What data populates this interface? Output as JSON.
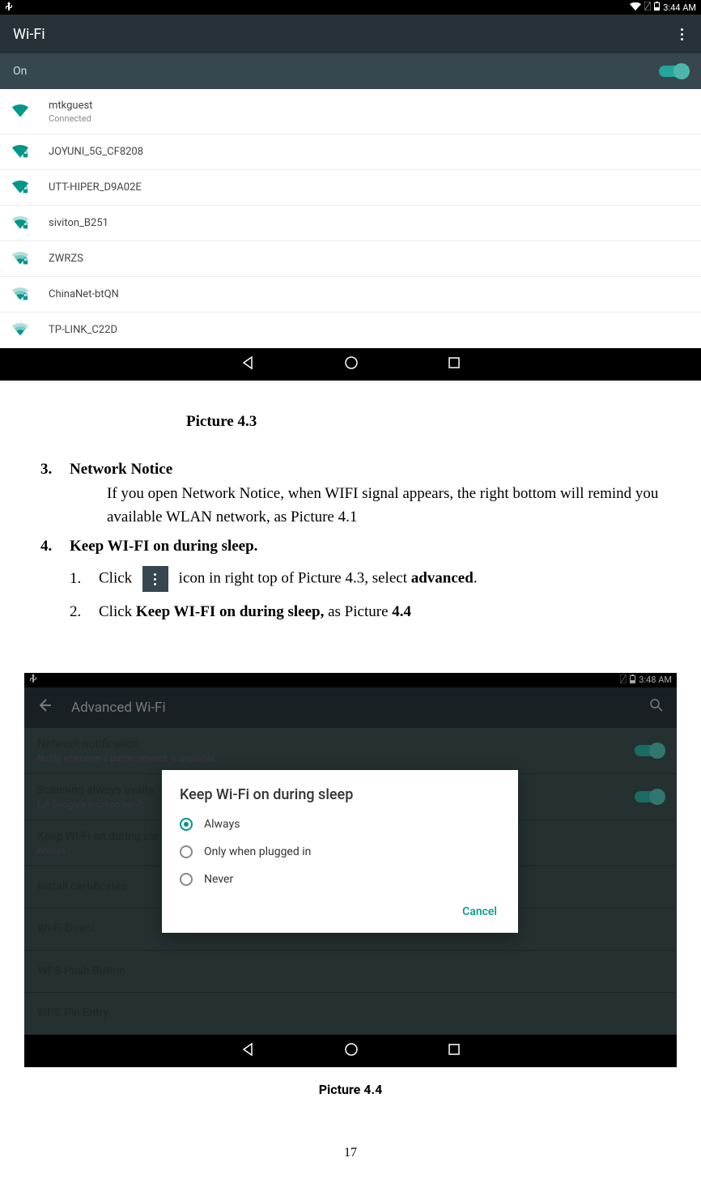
{
  "shot1": {
    "status_time": "3:44 AM",
    "title": "Wi-Fi",
    "on_label": "On",
    "networks": [
      {
        "name": "mtkguest",
        "status": "Connected",
        "strength": "full",
        "locked": false
      },
      {
        "name": "JOYUNI_5G_CF8208",
        "status": "",
        "strength": "full",
        "locked": true
      },
      {
        "name": "UTT-HIPER_D9A02E",
        "status": "",
        "strength": "full",
        "locked": true
      },
      {
        "name": "siviton_B251",
        "status": "",
        "strength": "high",
        "locked": true
      },
      {
        "name": "ZWRZS",
        "status": "",
        "strength": "med",
        "locked": true
      },
      {
        "name": "ChinaNet-btQN",
        "status": "",
        "strength": "med",
        "locked": true
      },
      {
        "name": "TP-LINK_C22D",
        "status": "",
        "strength": "med",
        "locked": false
      }
    ]
  },
  "caption1": "Picture 4.3",
  "body": {
    "item3_num": "3.",
    "item3_title": "Network Notice",
    "item3_text": "If you open Network Notice, when WIFI signal appears, the right bottom will remind you available WLAN network, as Picture 4.1",
    "item4_num": "4.",
    "item4_title": "Keep WI-FI on during sleep.",
    "sub1_num": "1.",
    "sub1_a": "Click ",
    "sub1_b": " icon in right top of Picture 4.3, select ",
    "sub1_c": "advanced",
    "sub1_d": ".",
    "sub2_num": "2.",
    "sub2_a": "Click ",
    "sub2_b": "Keep WI-FI on during sleep,",
    "sub2_c": " as Picture ",
    "sub2_d": "4.4"
  },
  "shot2": {
    "status_time": "3:48 AM",
    "title": "Advanced Wi-Fi",
    "rows": [
      {
        "t1": "Network notification",
        "t2": "Notify whenever a public network is available",
        "toggle": true
      },
      {
        "t1": "Scanning always availa",
        "t2": "Let Google's location servic",
        "toggle": true
      },
      {
        "t1": "Keep Wi-Fi on during sle",
        "t2": "Always",
        "toggle": false
      },
      {
        "t1": "Install certificates",
        "t2": "",
        "toggle": false
      },
      {
        "t1": "Wi-Fi Direct",
        "t2": "",
        "toggle": false
      },
      {
        "t1": "WPS Push Button",
        "t2": "",
        "toggle": false
      },
      {
        "t1": "WPS Pin Entry",
        "t2": "",
        "toggle": false
      }
    ],
    "dialog": {
      "title": "Keep Wi-Fi on during sleep",
      "options": [
        "Always",
        "Only when plugged in",
        "Never"
      ],
      "selected": 0,
      "cancel": "Cancel"
    }
  },
  "caption2": "Picture 4.4",
  "page_number": "17"
}
